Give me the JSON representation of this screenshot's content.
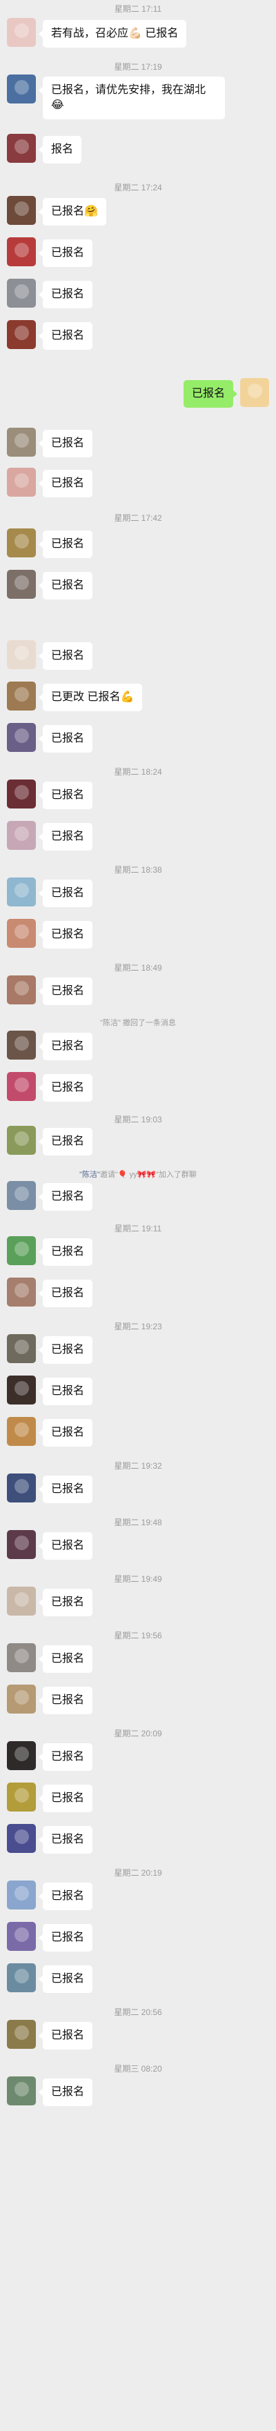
{
  "messages": [
    {
      "t": "time",
      "text": "星期二 17:11",
      "h": 26
    },
    {
      "t": "msg",
      "side": "left",
      "text": "若有战，召必应💪🏻 已报名",
      "avatar": "#e9c8c4",
      "h": 60
    },
    {
      "t": "time",
      "text": "星期二 17:19",
      "h": 22
    },
    {
      "t": "msg",
      "side": "left",
      "text": "已报名，请优先安排，我在湖北😂",
      "avatar": "#4a6fa0",
      "h": 86
    },
    {
      "t": "msg",
      "side": "left",
      "text": "报名",
      "avatar": "#8a3b3f",
      "h": 66
    },
    {
      "t": "time",
      "text": "星期二 17:24",
      "h": 24
    },
    {
      "t": "msg",
      "side": "left",
      "text": "已报名🤗",
      "avatar": "#6d4a3a",
      "h": 60
    },
    {
      "t": "msg",
      "side": "left",
      "text": "已报名",
      "avatar": "#b73b3b",
      "h": 60
    },
    {
      "t": "msg",
      "side": "left",
      "text": "已报名",
      "avatar": "#8c8f96",
      "h": 60
    },
    {
      "t": "msg",
      "side": "left",
      "text": "已报名",
      "avatar": "#8b3a2e",
      "h": 84
    },
    {
      "t": "msg",
      "side": "right",
      "text": "已报名",
      "avatar": "#f2d49b",
      "h": 72
    },
    {
      "t": "msg",
      "side": "left",
      "text": "已报名",
      "avatar": "#9a8d7a",
      "h": 58
    },
    {
      "t": "msg",
      "side": "left",
      "text": "已报名",
      "avatar": "#d9a7a0",
      "h": 58
    },
    {
      "t": "time",
      "text": "星期二 17:42",
      "h": 30
    },
    {
      "t": "msg",
      "side": "left",
      "text": "已报名",
      "avatar": "#a58a4c",
      "h": 60
    },
    {
      "t": "msg",
      "side": "left",
      "text": "已报名",
      "avatar": "#7c6f68",
      "h": 102
    },
    {
      "t": "msg",
      "side": "left",
      "text": "已报名",
      "avatar": "#e8dcd0",
      "h": 60
    },
    {
      "t": "msg",
      "side": "left",
      "text": "已更改 已报名💪",
      "avatar": "#9d7a52",
      "h": 60
    },
    {
      "t": "msg",
      "side": "left",
      "text": "已报名",
      "avatar": "#6a5f86",
      "h": 60
    },
    {
      "t": "time",
      "text": "星期二 18:24",
      "h": 22
    },
    {
      "t": "msg",
      "side": "left",
      "text": "已报名",
      "avatar": "#6b2e34",
      "h": 60
    },
    {
      "t": "msg",
      "side": "left",
      "text": "已报名",
      "avatar": "#c7a7b5",
      "h": 60
    },
    {
      "t": "time",
      "text": "星期二 18:38",
      "h": 22
    },
    {
      "t": "msg",
      "side": "left",
      "text": "已报名",
      "avatar": "#8fb7cf",
      "h": 60
    },
    {
      "t": "msg",
      "side": "left",
      "text": "已报名",
      "avatar": "#c98a72",
      "h": 60
    },
    {
      "t": "time",
      "text": "星期二 18:49",
      "h": 22
    },
    {
      "t": "msg",
      "side": "left",
      "text": "已报名",
      "avatar": "#a87966",
      "h": 58
    },
    {
      "t": "sys",
      "parts": [
        {
          "text": "\"陈洁\" 撤回了一条消息",
          "hl": false
        }
      ],
      "h": 22
    },
    {
      "t": "msg",
      "side": "left",
      "text": "已报名",
      "avatar": "#6b5448",
      "h": 60
    },
    {
      "t": "msg",
      "side": "left",
      "text": "已报名",
      "avatar": "#c24b6b",
      "h": 60
    },
    {
      "t": "time",
      "text": "星期二 19:03",
      "h": 18
    },
    {
      "t": "msg",
      "side": "left",
      "text": "已报名",
      "avatar": "#8a9a5b",
      "h": 62
    },
    {
      "t": "sys",
      "parts": [
        {
          "text": "\"陈洁\"",
          "hl": true
        },
        {
          "text": "邀请\"🎈 yy🎀🎀\"加入了群聊",
          "hl": false
        }
      ],
      "h": 18
    },
    {
      "t": "msg",
      "side": "left",
      "text": "已报名",
      "avatar": "#7a8fa6",
      "h": 58
    },
    {
      "t": "time",
      "text": "星期二 19:11",
      "h": 22
    },
    {
      "t": "msg",
      "side": "left",
      "text": "已报名",
      "avatar": "#5aa05a",
      "h": 60
    },
    {
      "t": "msg",
      "side": "left",
      "text": "已报名",
      "avatar": "#a57e6d",
      "h": 60
    },
    {
      "t": "time",
      "text": "星期二 19:23",
      "h": 22
    },
    {
      "t": "msg",
      "side": "left",
      "text": "已报名",
      "avatar": "#6e6a5e",
      "h": 60
    },
    {
      "t": "msg",
      "side": "left",
      "text": "已报名",
      "avatar": "#3c2f2a",
      "h": 60
    },
    {
      "t": "msg",
      "side": "left",
      "text": "已报名",
      "avatar": "#c08b4a",
      "h": 60
    },
    {
      "t": "time",
      "text": "星期二 19:32",
      "h": 22
    },
    {
      "t": "msg",
      "side": "left",
      "text": "已报名",
      "avatar": "#3d4f7a",
      "h": 60
    },
    {
      "t": "time",
      "text": "星期二 19:48",
      "h": 22
    },
    {
      "t": "msg",
      "side": "left",
      "text": "已报名",
      "avatar": "#5c3a4a",
      "h": 60
    },
    {
      "t": "time",
      "text": "星期二 19:49",
      "h": 22
    },
    {
      "t": "msg",
      "side": "left",
      "text": "已报名",
      "avatar": "#c9b7a8",
      "h": 60
    },
    {
      "t": "time",
      "text": "星期二 19:56",
      "h": 22
    },
    {
      "t": "msg",
      "side": "left",
      "text": "已报名",
      "avatar": "#8f8a86",
      "h": 60
    },
    {
      "t": "msg",
      "side": "left",
      "text": "已报名",
      "avatar": "#b59a74",
      "h": 60
    },
    {
      "t": "time",
      "text": "星期二 20:09",
      "h": 22
    },
    {
      "t": "msg",
      "side": "left",
      "text": "已报名",
      "avatar": "#2f2a2a",
      "h": 60
    },
    {
      "t": "msg",
      "side": "left",
      "text": "已报名",
      "avatar": "#b39c3a",
      "h": 60
    },
    {
      "t": "msg",
      "side": "left",
      "text": "已报名",
      "avatar": "#4a4d8f",
      "h": 60
    },
    {
      "t": "time",
      "text": "星期二 20:19",
      "h": 22
    },
    {
      "t": "msg",
      "side": "left",
      "text": "已报名",
      "avatar": "#8aa6cf",
      "h": 60
    },
    {
      "t": "msg",
      "side": "left",
      "text": "已报名",
      "avatar": "#7b6aa8",
      "h": 60
    },
    {
      "t": "msg",
      "side": "left",
      "text": "已报名",
      "avatar": "#6b8ca0",
      "h": 60
    },
    {
      "t": "time",
      "text": "星期二 20:56",
      "h": 22
    },
    {
      "t": "msg",
      "side": "left",
      "text": "已报名",
      "avatar": "#8b7a4a",
      "h": 60
    },
    {
      "t": "time",
      "text": "星期三 08:20",
      "h": 22
    },
    {
      "t": "msg",
      "side": "left",
      "text": "已报名",
      "avatar": "#6e8a6e",
      "h": 60
    }
  ]
}
